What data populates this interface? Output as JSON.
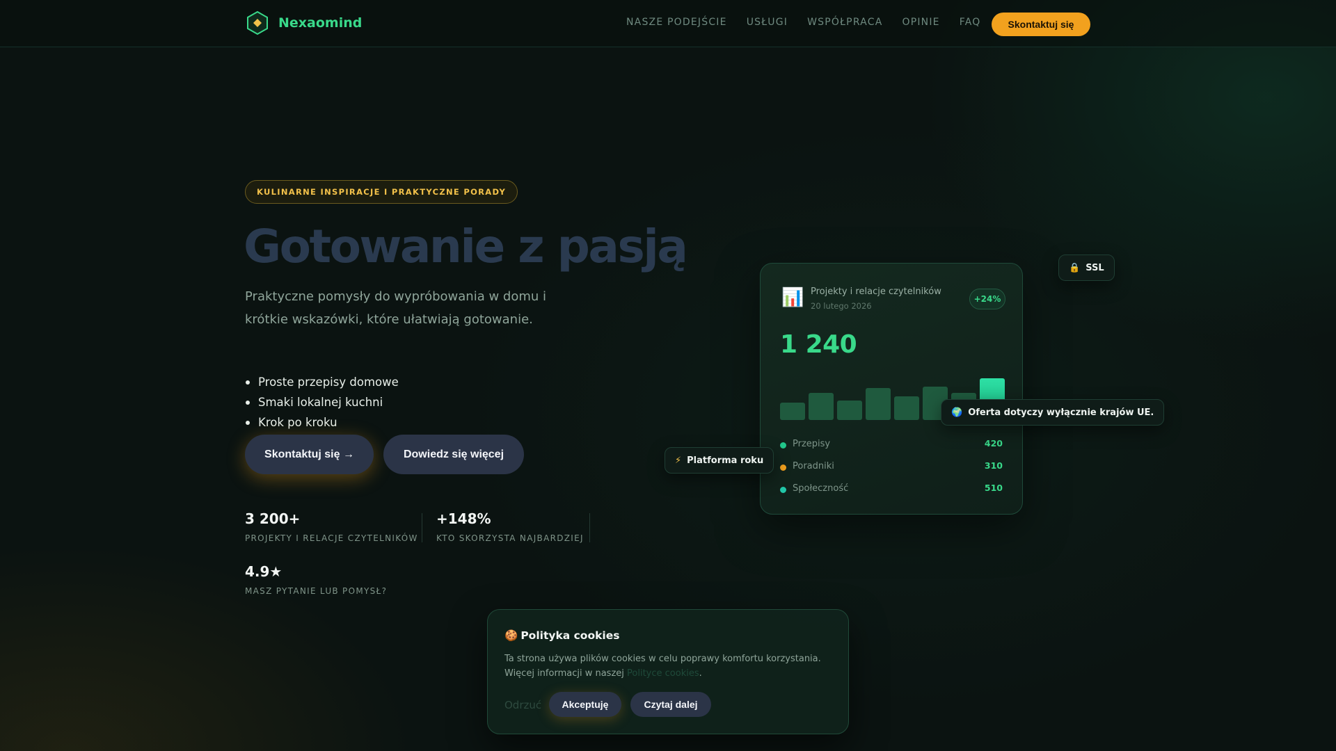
{
  "brand": {
    "name": "Nexaomind",
    "logo_icon": "hexagon-diamond-icon",
    "accent": "#39d98a"
  },
  "nav": {
    "links": [
      "NASZE PODEJŚCIE",
      "USŁUGI",
      "WSPÓŁPRACA",
      "OPINIE",
      "FAQ"
    ],
    "cta": "Skontaktuj się"
  },
  "hero": {
    "badge": "KULINARNE INSPIRACJE I PRAKTYCZNE PORADY",
    "title": "Gotowanie z pasją",
    "subtitle": "Praktyczne pomysły do wypróbowania w domu i krótkie wskazówki, które ułatwiają gotowanie.",
    "bullets": [
      "Proste przepisy domowe",
      "Smaki lokalnej kuchni",
      "Krok po kroku"
    ],
    "primary_button": "Skontaktuj się →",
    "secondary_button": "Dowiedz się więcej"
  },
  "stats": [
    {
      "value": "3 200+",
      "label": "PROJEKTY I RELACJE CZYTELNIKÓW"
    },
    {
      "value": "+148%",
      "label": "KTO SKORZYSTA NAJBARDZIEJ"
    },
    {
      "value": "4.9★",
      "label": "MASZ PYTANIE LUB POMYSŁ?"
    }
  ],
  "dashboard": {
    "icon": "bar-chart-icon",
    "title": "Projekty i relacje czytelników",
    "date": "20 lutego 2026",
    "change": "+24%",
    "total": "1 240",
    "bar_levels": [
      0.35,
      0.55,
      0.4,
      0.65,
      0.48,
      0.68,
      0.55,
      0.85
    ],
    "legend": [
      {
        "name": "Przepisy",
        "value": "420",
        "color": "#22c78b"
      },
      {
        "name": "Poradniki",
        "value": "310",
        "color": "#f2a11e"
      },
      {
        "name": "Społeczność",
        "value": "510",
        "color": "#22c7a8"
      }
    ]
  },
  "chips": {
    "ssl": {
      "icon": "lock-icon",
      "label": "SSL"
    },
    "eu": {
      "icon": "globe-icon",
      "label": "Oferta dotyczy wyłącznie krajów UE."
    },
    "platform": {
      "icon": "lightning-icon",
      "label": "Platforma roku"
    }
  },
  "cookie": {
    "title": "Polityka cookies",
    "icon": "cookie-icon",
    "text": "Ta strona używa plików cookies w celu poprawy komfortu korzystania. Więcej informacji w naszej",
    "link": "Polityce cookies",
    "reject": "Odrzuć",
    "accept": "Akceptuję",
    "more": "Czytaj dalej"
  }
}
